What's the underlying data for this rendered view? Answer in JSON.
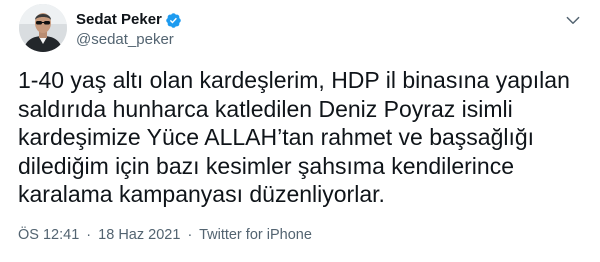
{
  "author": {
    "name": "Sedat Peker",
    "handle": "@sedat_peker",
    "verified": true
  },
  "tweet": {
    "text": "1-40 yaş altı olan kardeşlerim, HDP il binasına yapılan saldırıda hunharca katledilen Deniz Poyraz isimli kardeşimize Yüce ALLAH’tan rahmet ve başsağlığı dilediğim için bazı kesimler şahsıma kendilerince karalama kampanyası düzenliyorlar."
  },
  "meta": {
    "time": "ÖS 12:41",
    "separator": "·",
    "date": "18 Haz 2021",
    "source": "Twitter for iPhone"
  },
  "icons": {
    "verified": "verified-badge-icon",
    "more": "chevron-down-icon"
  },
  "colors": {
    "verified": "#1d9bf0",
    "secondary_text": "#536471",
    "primary_text": "#0f1419"
  }
}
